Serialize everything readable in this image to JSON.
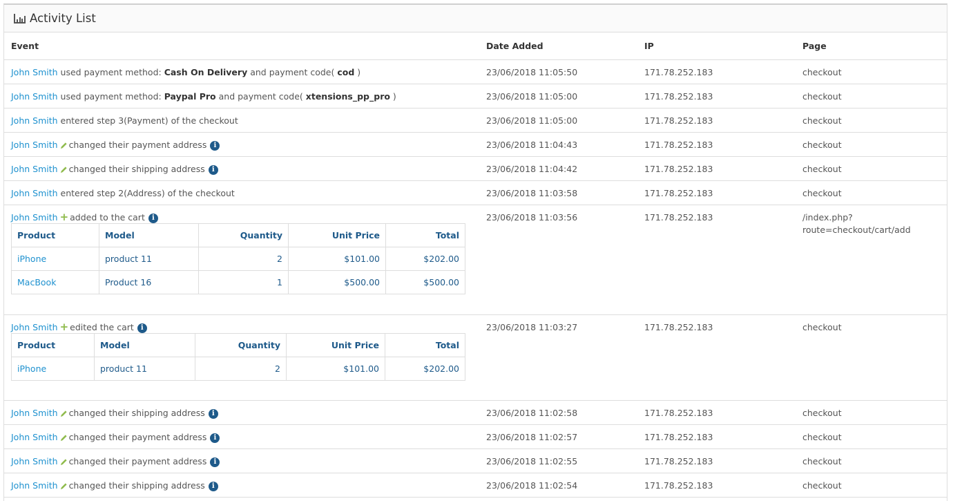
{
  "panel": {
    "title": "Activity List",
    "icon": "bar-chart-icon"
  },
  "columns": {
    "event": "Event",
    "date": "Date Added",
    "ip": "IP",
    "page": "Page"
  },
  "subtable_headers": {
    "product": "Product",
    "model": "Model",
    "quantity": "Quantity",
    "unit_price": "Unit Price",
    "total": "Total"
  },
  "rows": [
    {
      "user": "John Smith",
      "t1": " used payment method: ",
      "b1": "Cash On Delivery",
      "t2": " and payment code( ",
      "b2": "cod",
      "t3": " )",
      "date": "23/06/2018 11:05:50",
      "ip": "171.78.252.183",
      "page": "checkout"
    },
    {
      "user": "John Smith",
      "t1": " used payment method: ",
      "b1": "Paypal Pro",
      "t2": " and payment code( ",
      "b2": "xtensions_pp_pro",
      "t3": " )",
      "date": "23/06/2018 11:05:00",
      "ip": "171.78.252.183",
      "page": "checkout"
    },
    {
      "user": "John Smith",
      "text": " entered step 3(Payment) of the checkout",
      "date": "23/06/2018 11:05:00",
      "ip": "171.78.252.183",
      "page": "checkout"
    },
    {
      "user": "John Smith",
      "text": "changed their payment address",
      "date": "23/06/2018 11:04:43",
      "ip": "171.78.252.183",
      "page": "checkout"
    },
    {
      "user": "John Smith",
      "text": "changed their shipping address",
      "date": "23/06/2018 11:04:42",
      "ip": "171.78.252.183",
      "page": "checkout"
    },
    {
      "user": "John Smith",
      "text": " entered step 2(Address) of the checkout",
      "date": "23/06/2018 11:03:58",
      "ip": "171.78.252.183",
      "page": "checkout"
    },
    {
      "user": "John Smith",
      "text": "added to the cart",
      "date": "23/06/2018 11:03:56",
      "ip": "171.78.252.183",
      "page": "/index.php? route=checkout/cart/add",
      "items": [
        {
          "product": "iPhone",
          "model": "product 11",
          "quantity": "2",
          "unit_price": "$101.00",
          "total": "$202.00"
        },
        {
          "product": "MacBook",
          "model": "Product 16",
          "quantity": "1",
          "unit_price": "$500.00",
          "total": "$500.00"
        }
      ]
    },
    {
      "user": "John Smith",
      "text": "edited the cart",
      "date": "23/06/2018 11:03:27",
      "ip": "171.78.252.183",
      "page": "checkout",
      "items": [
        {
          "product": "iPhone",
          "model": "product 11",
          "quantity": "2",
          "unit_price": "$101.00",
          "total": "$202.00"
        }
      ]
    },
    {
      "user": "John Smith",
      "text": "changed their shipping address",
      "date": "23/06/2018 11:02:58",
      "ip": "171.78.252.183",
      "page": "checkout"
    },
    {
      "user": "John Smith",
      "text": "changed their payment address",
      "date": "23/06/2018 11:02:57",
      "ip": "171.78.252.183",
      "page": "checkout"
    },
    {
      "user": "John Smith",
      "text": "changed their payment address",
      "date": "23/06/2018 11:02:55",
      "ip": "171.78.252.183",
      "page": "checkout"
    },
    {
      "user": "John Smith",
      "text": "changed their shipping address",
      "date": "23/06/2018 11:02:54",
      "ip": "171.78.252.183",
      "page": "checkout"
    }
  ],
  "colors": {
    "link": "#1e91cf",
    "subtable_text": "#1e5a8a",
    "plus_icon": "#8fbb4c",
    "pencil_icon": "#8fbb4c"
  }
}
